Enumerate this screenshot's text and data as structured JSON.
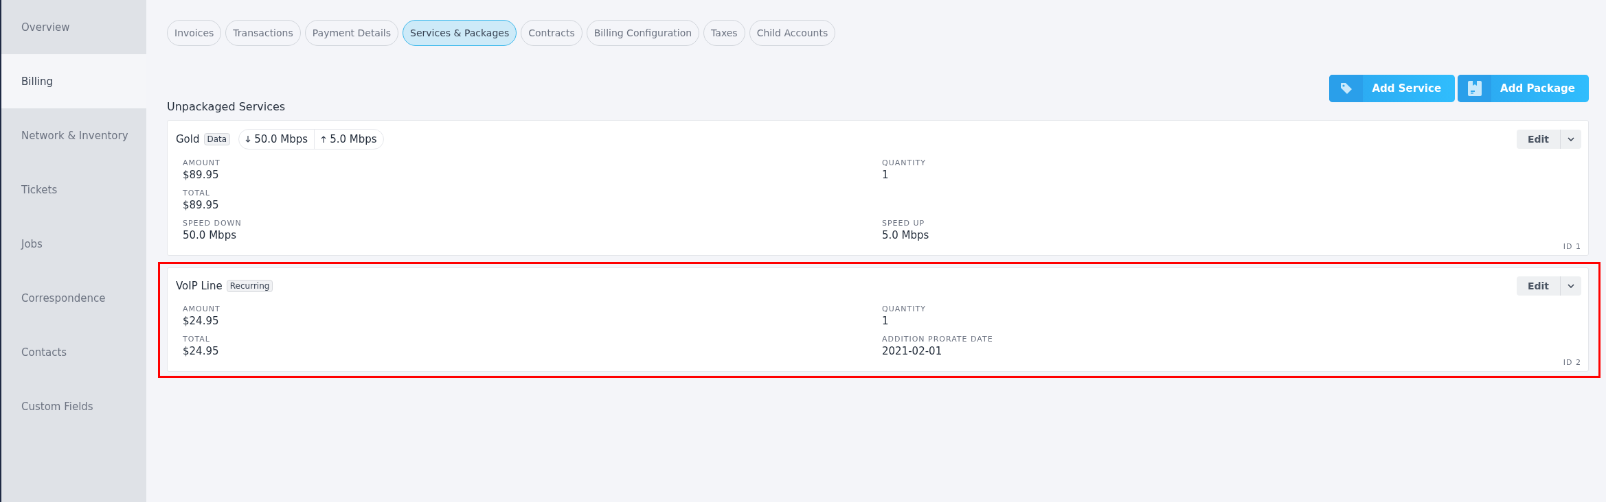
{
  "sidebar": {
    "items": [
      {
        "label": "Overview",
        "selected": false
      },
      {
        "label": "Billing",
        "selected": true
      },
      {
        "label": "Network & Inventory",
        "selected": false
      },
      {
        "label": "Tickets",
        "selected": false
      },
      {
        "label": "Jobs",
        "selected": false
      },
      {
        "label": "Correspondence",
        "selected": false
      },
      {
        "label": "Contacts",
        "selected": false
      },
      {
        "label": "Custom Fields",
        "selected": false
      }
    ]
  },
  "tabs": [
    {
      "label": "Invoices",
      "selected": false
    },
    {
      "label": "Transactions",
      "selected": false
    },
    {
      "label": "Payment Details",
      "selected": false
    },
    {
      "label": "Services & Packages",
      "selected": true
    },
    {
      "label": "Contracts",
      "selected": false
    },
    {
      "label": "Billing Configuration",
      "selected": false
    },
    {
      "label": "Taxes",
      "selected": false
    },
    {
      "label": "Child Accounts",
      "selected": false
    }
  ],
  "actions": [
    {
      "label": "Add Service",
      "kind": "tag"
    },
    {
      "label": "Add Package",
      "kind": "package"
    }
  ],
  "section_title": "Unpackaged Services",
  "services": [
    {
      "name": "Gold",
      "badge": "Data",
      "highlighted": false,
      "speed_down": "50.0 Mbps",
      "speed_up": "5.0 Mbps",
      "edit_label": "Edit",
      "id": "ID 1",
      "rows": [
        [
          {
            "label": "AMOUNT",
            "value": "$89.95"
          },
          {
            "label": "QUANTITY",
            "value": "1"
          }
        ],
        [
          {
            "label": "TOTAL",
            "value": "$89.95"
          }
        ],
        [
          {
            "label": "SPEED DOWN",
            "value": "50.0 Mbps"
          },
          {
            "label": "SPEED UP",
            "value": "5.0 Mbps"
          }
        ]
      ]
    },
    {
      "name": "VoIP Line",
      "badge": "Recurring",
      "highlighted": true,
      "edit_label": "Edit",
      "id": "ID 2",
      "rows": [
        [
          {
            "label": "AMOUNT",
            "value": "$24.95"
          },
          {
            "label": "QUANTITY",
            "value": "1"
          }
        ],
        [
          {
            "label": "TOTAL",
            "value": "$24.95"
          },
          {
            "label": "ADDITION PRORATE DATE",
            "value": "2021-02-01"
          }
        ]
      ]
    }
  ]
}
